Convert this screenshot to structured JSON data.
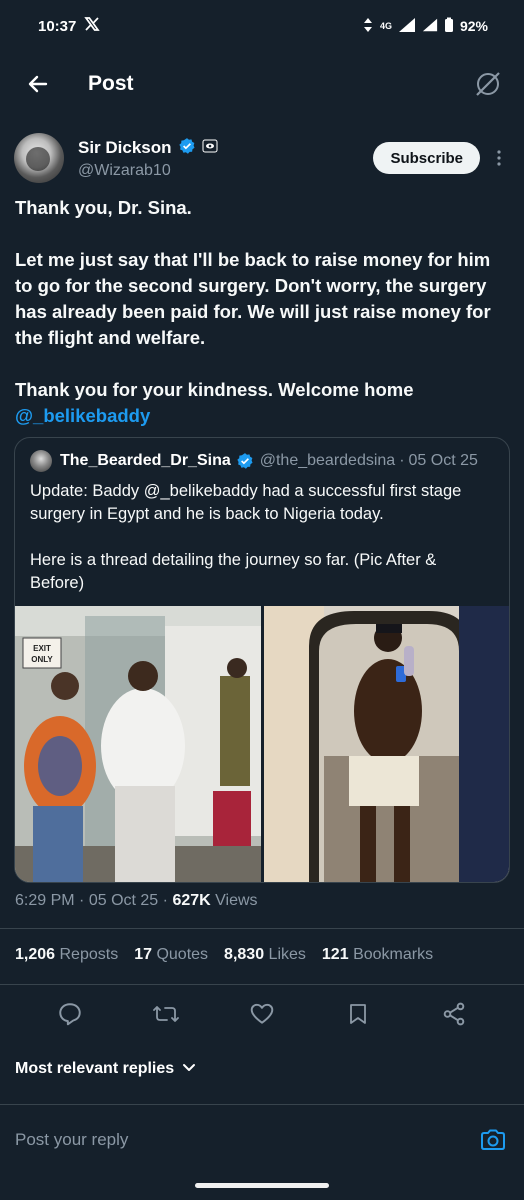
{
  "status": {
    "time": "10:37",
    "app_icon": "x-logo-icon",
    "network": "4G",
    "battery": "92%"
  },
  "header": {
    "title": "Post"
  },
  "author": {
    "name": "Sir Dickson",
    "handle": "@Wizarab10",
    "subscribe_label": "Subscribe"
  },
  "tweet": {
    "line1": "Thank you, Dr. Sina.",
    "line2": "Let me just say that I'll be back to raise money for him to go for the second surgery. Don't worry, the surgery has already been paid for. We will just raise money for the flight and welfare.",
    "line3": "Thank you for your kindness. Welcome home",
    "mention": "@_belikebaddy"
  },
  "quote": {
    "name": "The_Bearded_Dr_Sina",
    "handle": "@the_beardedsina",
    "date": "05 Oct 25",
    "text1": "Update: Baddy @_belikebaddy had a successful first stage surgery in Egypt and he is back to Nigeria today.",
    "text2": "Here is a thread detailing the journey so far. (Pic After & Before)",
    "sign1": "EXIT",
    "sign2": "ONLY"
  },
  "meta": {
    "time": "6:29 PM",
    "date": "05 Oct 25",
    "views": "627K",
    "views_label": "Views"
  },
  "stats": {
    "reposts": "1,206",
    "reposts_label": "Reposts",
    "quotes": "17",
    "quotes_label": "Quotes",
    "likes": "8,830",
    "likes_label": "Likes",
    "bookmarks": "121",
    "bookmarks_label": "Bookmarks"
  },
  "replies": {
    "sort_label": "Most relevant replies",
    "placeholder": "Post your reply"
  },
  "colors": {
    "background": "#15202b",
    "accent": "#1d9bf0",
    "muted": "#8b98a5"
  }
}
